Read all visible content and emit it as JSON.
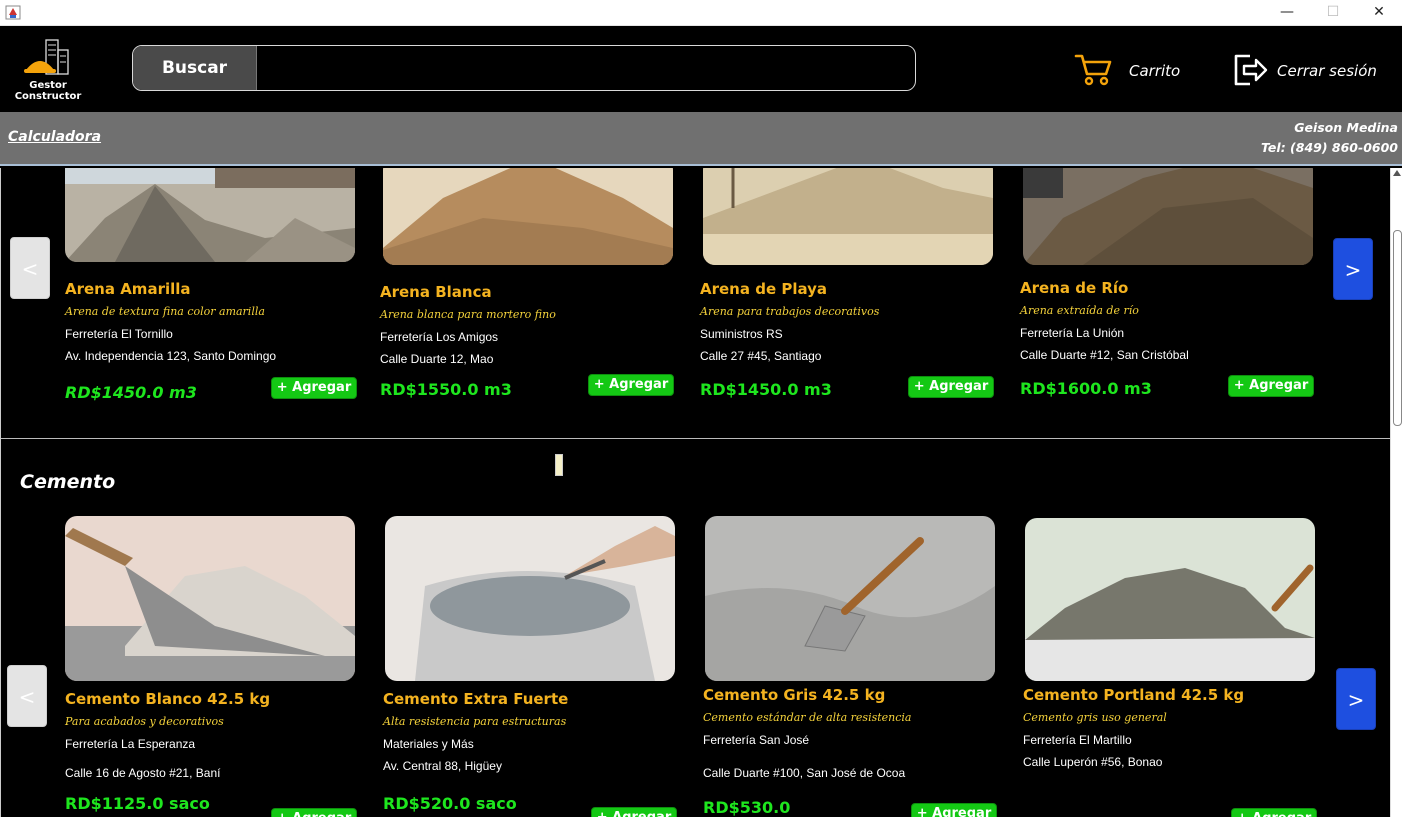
{
  "window": {
    "minimize": "—",
    "maximize": "☐",
    "close": "✕"
  },
  "header": {
    "logo_line1": "Gestor",
    "logo_line2": "Constructor",
    "search_button": "Buscar",
    "search_value": "",
    "cart_label": "Carrito",
    "logout_label": "Cerrar sesión",
    "accent_color": "#f4a30b"
  },
  "subbar": {
    "calculator_link": "Calculadora",
    "user_name": "Geison Medina",
    "user_phone": "Tel: (849) 860-0600"
  },
  "nav": {
    "prev": "<",
    "next": ">"
  },
  "sections": [
    {
      "title": "",
      "products": [
        {
          "name": "Arena Amarilla",
          "desc": "Arena de textura fina color amarilla",
          "store": "Ferretería El Tornillo",
          "addr": "Av. Independencia 123, Santo Domingo",
          "price": "RD$1450.0 m3",
          "add": "+ Agregar",
          "image": "gravel-pile-image"
        },
        {
          "name": "Arena Blanca",
          "desc": "Arena blanca para mortero fino",
          "store": "Ferretería Los Amigos",
          "addr": "Calle Duarte 12, Mao",
          "price": "RD$1550.0 m3",
          "add": "+ Agregar",
          "image": "sand-pile-image"
        },
        {
          "name": "Arena de Playa",
          "desc": "Arena para trabajos decorativos",
          "store": "Suministros RS",
          "addr": "Calle 27 #45, Santiago",
          "price": "RD$1450.0 m3",
          "add": "+ Agregar",
          "image": "beach-sand-image"
        },
        {
          "name": "Arena de Río",
          "desc": "Arena extraída de río",
          "store": "Ferretería La Unión",
          "addr": "Calle Duarte #12, San Cristóbal",
          "price": "RD$1600.0 m3",
          "add": "+ Agregar",
          "image": "river-sand-image"
        }
      ]
    },
    {
      "title": "Cemento",
      "products": [
        {
          "name": "Cemento Blanco 42.5 kg",
          "desc": "Para acabados y decorativos",
          "store": "Ferretería La Esperanza",
          "addr": "Calle 16 de Agosto #21, Baní",
          "price": "RD$1125.0 saco",
          "add": "+ Agregar",
          "image": "white-cement-image"
        },
        {
          "name": "Cemento Extra Fuerte",
          "desc": "Alta resistencia para estructuras",
          "store": "Materiales y Más",
          "addr": "Av. Central 88, Higüey",
          "price": "RD$520.0 saco",
          "add": "+ Agregar",
          "image": "cement-bag-image"
        },
        {
          "name": "Cemento Gris 42.5 kg",
          "desc": "Cemento estándar de alta resistencia",
          "store": "Ferretería San José",
          "addr": "Calle Duarte #100, San José de Ocoa",
          "price": "RD$530.0",
          "add": "+ Agregar",
          "image": "grey-cement-image"
        },
        {
          "name": "Cemento Portland 42.5 kg",
          "desc": "Cemento gris uso general",
          "store": "Ferretería El Martillo",
          "addr": "Calle Luperón #56, Bonao",
          "price": "",
          "add": "+ Agregar",
          "image": "portland-cement-image"
        }
      ]
    }
  ]
}
